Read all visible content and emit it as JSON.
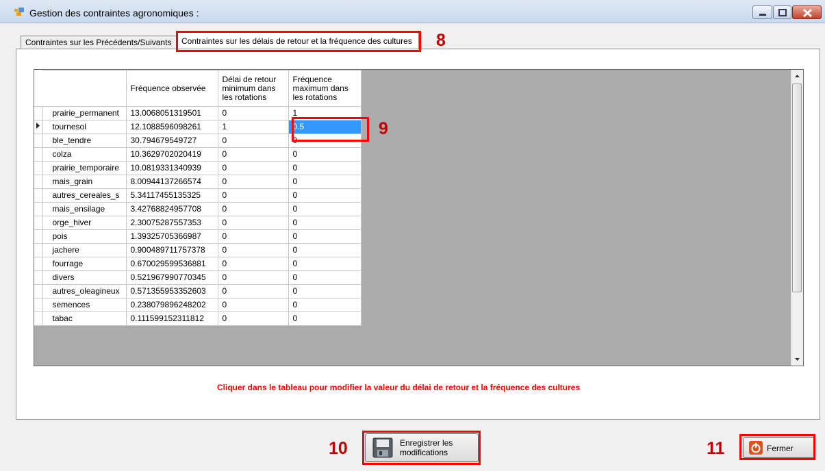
{
  "window": {
    "title": "Gestion des contraintes agronomiques :"
  },
  "tabs": [
    {
      "label": "Contraintes sur les Précédents/Suivants"
    },
    {
      "label": "Contraintes sur les délais de retour et la fréquence des cultures"
    }
  ],
  "grid": {
    "columns": [
      "Fréquence observée",
      "Délai de retour minimum dans les rotations",
      "Fréquence maximum dans les rotations"
    ],
    "rows": [
      {
        "name": "prairie_permanent",
        "freq": "13.0068051319501",
        "delai": "0",
        "max": "1"
      },
      {
        "name": "tournesol",
        "freq": "12.1088596098261",
        "delai": "1",
        "max": "0.5"
      },
      {
        "name": "ble_tendre",
        "freq": "30.794679549727",
        "delai": "0",
        "max": "0"
      },
      {
        "name": "colza",
        "freq": "10.3629702020419",
        "delai": "0",
        "max": "0"
      },
      {
        "name": "prairie_temporaire",
        "freq": "10.0819331340939",
        "delai": "0",
        "max": "0"
      },
      {
        "name": "mais_grain",
        "freq": "8.00944137266574",
        "delai": "0",
        "max": "0"
      },
      {
        "name": "autres_cereales_s",
        "freq": "5.34117455135325",
        "delai": "0",
        "max": "0"
      },
      {
        "name": "mais_ensilage",
        "freq": "3.42768824957708",
        "delai": "0",
        "max": "0"
      },
      {
        "name": "orge_hiver",
        "freq": "2.30075287557353",
        "delai": "0",
        "max": "0"
      },
      {
        "name": "pois",
        "freq": "1.39325705366987",
        "delai": "0",
        "max": "0"
      },
      {
        "name": "jachere",
        "freq": "0.900489711757378",
        "delai": "0",
        "max": "0"
      },
      {
        "name": "fourrage",
        "freq": "0.670029599536881",
        "delai": "0",
        "max": "0"
      },
      {
        "name": "divers",
        "freq": "0.521967990770345",
        "delai": "0",
        "max": "0"
      },
      {
        "name": "autres_oleagineux",
        "freq": "0.571355953352603",
        "delai": "0",
        "max": "0"
      },
      {
        "name": "semences",
        "freq": "0.238079896248202",
        "delai": "0",
        "max": "0"
      },
      {
        "name": "tabac",
        "freq": "0.111599152311812",
        "delai": "0",
        "max": "0"
      }
    ]
  },
  "hint": "Cliquer dans le tableau pour modifier la valeur du délai de retour et la fréquence des cultures",
  "buttons": {
    "save": "Enregistrer les modifications",
    "close": "Fermer"
  },
  "annotations": {
    "n8": "8",
    "n9": "9",
    "n10": "10",
    "n11": "11"
  },
  "colors": {
    "annotation": "#ff0000",
    "hint": "#ff0000",
    "selection": "#3399ff"
  },
  "icons": [
    "app-icon",
    "minimize-icon",
    "maximize-icon",
    "close-icon",
    "row-pointer-icon",
    "floppy-disk-icon",
    "power-icon"
  ]
}
